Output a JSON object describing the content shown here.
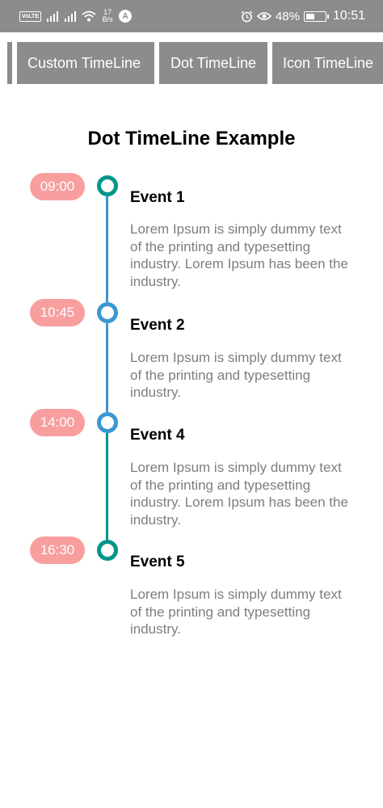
{
  "status_bar": {
    "volte": "VoLTE",
    "net_speed_value": "17",
    "net_speed_unit": "B/s",
    "nav_badge": "A",
    "battery_percent": "48%",
    "battery_level": 0.48,
    "time": "10:51",
    "icons": [
      "volte-icon",
      "signal-icon",
      "signal-icon",
      "wifi-icon",
      "alarm-icon",
      "eye-icon",
      "battery-icon"
    ]
  },
  "tabs": [
    {
      "label": ""
    },
    {
      "label": "Custom TimeLine"
    },
    {
      "label": "Dot TimeLine"
    },
    {
      "label": "Icon TimeLine"
    }
  ],
  "title": "Dot TimeLine Example",
  "colors": {
    "header_bg": "#8c8c8c",
    "tab_bg": "#8c8c8c",
    "time_pill": "#f99e9e",
    "teal": "#009688",
    "blue": "#3a97d4",
    "desc_text": "#7e7e7e"
  },
  "events": [
    {
      "time": "09:00",
      "title": "Event 1",
      "description": "Lorem Ipsum is simply dummy text of the printing and typesetting industry. Lorem Ipsum has been the industry.",
      "dot_color": "#009688"
    },
    {
      "time": "10:45",
      "title": "Event 2",
      "description": "Lorem Ipsum is simply dummy text of the printing and typesetting industry.",
      "dot_color": "#3a97d4"
    },
    {
      "time": "14:00",
      "title": "Event 4",
      "description": "Lorem Ipsum is simply dummy text of the printing and typesetting industry. Lorem Ipsum has been the industry.",
      "dot_color": "#3a97d4"
    },
    {
      "time": "16:30",
      "title": "Event 5",
      "description": "Lorem Ipsum is simply dummy text of the printing and typesetting industry.",
      "dot_color": "#009688"
    }
  ]
}
